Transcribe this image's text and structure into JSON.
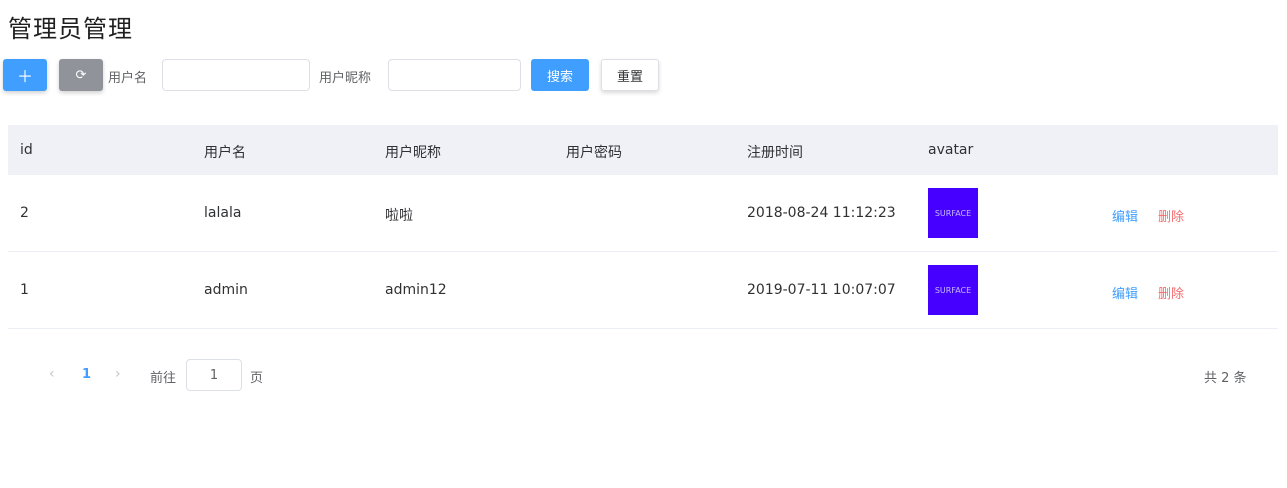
{
  "page": {
    "title": "管理员管理"
  },
  "toolbar": {
    "add_icon": "＋",
    "refresh_icon": "⟳",
    "username_label": "用户名",
    "username_value": "",
    "nickname_label": "用户昵称",
    "nickname_value": "",
    "search_label": "搜索",
    "reset_label": "重置"
  },
  "table": {
    "headers": {
      "id": "id",
      "username": "用户名",
      "nickname": "用户昵称",
      "password": "用户密码",
      "register_time": "注册时间",
      "avatar": "avatar"
    },
    "rows": [
      {
        "id": "2",
        "username": "lalala",
        "nickname": "啦啦",
        "password": "",
        "register_time": "2018-08-24 11:12:23",
        "avatar_text": "SURFACE",
        "avatar_color": "#4500ff",
        "edit": "编辑",
        "delete": "删除"
      },
      {
        "id": "1",
        "username": "admin",
        "nickname": "admin12",
        "password": "",
        "register_time": "2019-07-11 10:07:07",
        "avatar_text": "SURFACE",
        "avatar_color": "#4500ff",
        "edit": "编辑",
        "delete": "删除"
      }
    ]
  },
  "pagination": {
    "prev_icon": "‹",
    "next_icon": "›",
    "current_page": "1",
    "goto_label": "前往",
    "goto_value": "1",
    "page_suffix": "页",
    "total_text": "共 2 条"
  },
  "colors": {
    "primary": "#409eff",
    "info": "#909399",
    "danger": "#f56c6c",
    "header_bg": "#f0f1f6"
  }
}
